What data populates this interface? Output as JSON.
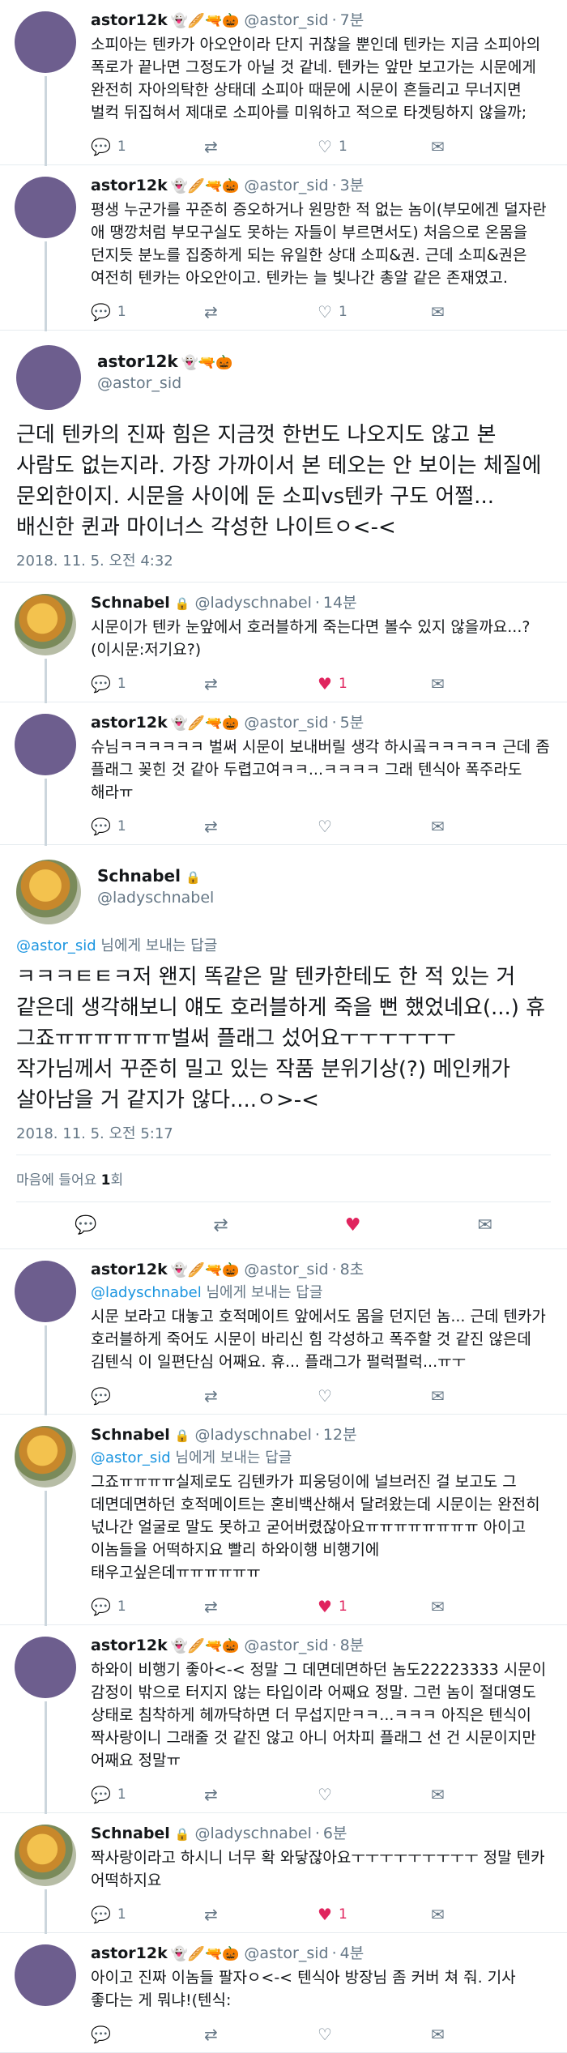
{
  "tweets": [
    {
      "name": "astor12k",
      "emojis": "👻🥖🔫🎃",
      "handle": "@astor_sid",
      "time": "7분",
      "text": "소피아는 텐카가 아오안이라 단지 귀찮을 뿐인데 텐카는 지금 소피아의 폭로가 끝나면 그정도가 아닐 것 같네. 텐카는 앞만 보고가는 시문에게 완전히 자아의탁한 상태데 소피아 때문에 시문이 흔들리고 무너지면 벌컥 뒤집혀서 제대로 소피아를 미워하고 적으로 타겟팅하지 않을까;",
      "reply": "1",
      "rt": "",
      "like": "1",
      "liked": false,
      "avatar": "purple"
    },
    {
      "name": "astor12k",
      "emojis": "👻🥖🔫🎃",
      "handle": "@astor_sid",
      "time": "3분",
      "text": "평생 누군가를 꾸준히 증오하거나 원망한 적 없는 놈이(부모에겐 덜자란 애 땡깡처럼 부모구실도 못하는 자들이 부르면서도) 처음으로 온몸을 던지듯 분노를 집중하게 되는 유일한 상대 소피&권. 근데 소피&권은 여전히 텐카는 아오안이고. 텐카는 늘 빛나간 총알 같은 존재였고.",
      "reply": "1",
      "rt": "",
      "like": "1",
      "liked": false,
      "avatar": "purple"
    }
  ],
  "focus1": {
    "name": "astor12k",
    "emojis": "👻🔫🎃",
    "handle": "@astor_sid",
    "text": "근데 텐카의 진짜 힘은 지금껏 한번도 나오지도 않고 본 사람도 없는지라. 가장 가까이서 본 테오는 안 보이는 체질에 문외한이지. 시문을 사이에 둔 소피vs텐카 구도 어쩔... 배신한 퀸과 마이너스 각성한 나이트ㅇ<-<",
    "stamp": "2018. 11. 5. 오전 4:32"
  },
  "tweets2": [
    {
      "name": "Schnabel",
      "emojis": "",
      "lock": "🔒",
      "handle": "@ladyschnabel",
      "time": "14분",
      "text": "시문이가 텐카 눈앞에서 호러블하게 죽는다면 볼수 있지 않을까요...? (이시문:저기요?)",
      "reply": "1",
      "rt": "",
      "like": "1",
      "liked": true,
      "avatar": "photo"
    },
    {
      "name": "astor12k",
      "emojis": "👻🥖🔫🎃",
      "handle": "@astor_sid",
      "time": "5분",
      "text": "슈님ㅋㅋㅋㅋㅋㅋ 벌써 시문이 보내버릴 생각 하시곸ㅋㅋㅋㅋㅋ 근데 좀 플래그 꽂힌 것 같아 두렵고여ㅋㅋ...ㅋㅋㅋㅋ 그래 텐식아 폭주라도 해라ㅠ",
      "reply": "1",
      "rt": "",
      "like": "",
      "liked": false,
      "avatar": "purple"
    }
  ],
  "focus2": {
    "name": "Schnabel",
    "lock": "🔒",
    "handle": "@ladyschnabel",
    "replying_to": "@astor_sid",
    "replying_suffix": " 님에게 보내는 답글",
    "text": "ㅋㅋㅋㅌㅌㅋ저 왠지 똑같은 말 텐카한테도 한 적 있는 거 같은데 생각해보니 얘도 호러블하게 죽을 뻔 했었네요(...) 휴 그죠ㅠㅠㅠㅠㅠㅠ벌써 플래그 섰어요ㅜㅜㅜㅜㅜㅜ 작가님께서 꾸준히 밀고 있는 작품 분위기상(?) 메인캐가 살아남을 거 같지가 않다....ㅇ>-<",
    "stamp": "2018. 11. 5. 오전 5:17",
    "likes_prefix": "마음에 들어요 ",
    "likes_count": "1",
    "likes_suffix": "회"
  },
  "tweets3": [
    {
      "name": "astor12k",
      "emojis": "👻🥖🔫🎃",
      "handle": "@astor_sid",
      "time": "8초",
      "replying_to": "@ladyschnabel",
      "replying_suffix": " 님에게 보내는 답글",
      "text": "시문 보라고 대놓고 호적메이트 앞에서도 몸을 던지던 놈... 근데 텐카가 호러블하게 죽어도 시문이 바리신 힘 각성하고 폭주할 것 같진 않은데 김텐식 이 일편단심 어째요. 휴... 플래그가 펄럭펄럭...ㅠㅜ",
      "reply": "",
      "rt": "",
      "like": "",
      "liked": false,
      "avatar": "purple"
    },
    {
      "name": "Schnabel",
      "emojis": "",
      "lock": "🔒",
      "handle": "@ladyschnabel",
      "time": "12분",
      "replying_to": "@astor_sid",
      "replying_suffix": " 님에게 보내는 답글",
      "text": "그죠ㅠㅠㅠㅠ실제로도 김텐카가 피웅덩이에 널브러진 걸 보고도 그 데면데면하던 호적메이트는 혼비백산해서 달려왔는데 시문이는 완전히 넋나간 얼굴로 말도 못하고 굳어버렸잖아요ㅠㅠㅠㅠㅠㅠㅠㅠ 아이고 이놈들을 어떡하지요 빨리 하와이행 비행기에 태우고싶은데ㅠㅠㅠㅠㅠㅠ",
      "reply": "1",
      "rt": "",
      "like": "1",
      "liked": true,
      "avatar": "photo"
    },
    {
      "name": "astor12k",
      "emojis": "👻🥖🔫🎃",
      "handle": "@astor_sid",
      "time": "8분",
      "text": "하와이 비행기 좋아<-< 정말 그 데면데면하던 놈도22223333 시문이 감정이 밖으로 터지지 않는 타입이라 어째요 정말. 그런 놈이 절대영도 상태로 침착하게 헤까닥하면 더 무섭지만ㅋㅋ...ㅋㅋㅋ 아직은 텐식이 짝사랑이니 그래줄 것 같진 않고 아니 어차피 플래그 선 건 시문이지만 어째요 정말ㅠ",
      "reply": "1",
      "rt": "",
      "like": "",
      "liked": false,
      "avatar": "purple"
    },
    {
      "name": "Schnabel",
      "emojis": "",
      "lock": "🔒",
      "handle": "@ladyschnabel",
      "time": "6분",
      "text": "짝사랑이라고 하시니 너무 확 와닿잖아요ㅜㅜㅜㅜㅜㅜㅜㅜㅜ 정말 텐카 어떡하지요",
      "reply": "1",
      "rt": "",
      "like": "1",
      "liked": true,
      "avatar": "photo"
    },
    {
      "name": "astor12k",
      "emojis": "👻🥖🔫🎃",
      "handle": "@astor_sid",
      "time": "4분",
      "text": "아이고 진짜 이놈들 팔자ㅇ<-< 텐식아 방장님 좀 커버 쳐 줘. 기사 좋다는 게 뭐냐!(텐식:",
      "reply": "",
      "rt": "",
      "like": "",
      "liked": false,
      "avatar": "purple"
    }
  ],
  "icons": {
    "reply": "reply-icon",
    "retweet": "retweet-icon",
    "like": "heart-icon",
    "dm": "mail-icon"
  },
  "colors": {
    "like": "#e0245e",
    "link": "#1b95e0",
    "muted": "#657786",
    "avatar": "#6d5e8e"
  }
}
